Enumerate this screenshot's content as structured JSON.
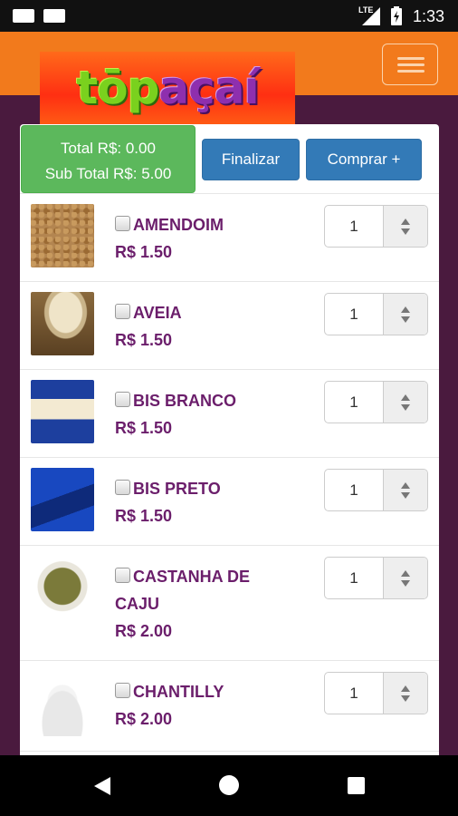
{
  "status_bar": {
    "time": "1:33",
    "network": "LTE"
  },
  "header": {
    "logo_text_green": "tōp",
    "logo_text_purple": "açaí",
    "menu_icon": "hamburger-icon"
  },
  "cart": {
    "total": "Total R$: 0.00",
    "subtotal": "Sub Total R$: 5.00",
    "finalize_label": "Finalizar",
    "buy_label": "Comprar +"
  },
  "products": [
    {
      "name": "AMENDOIM",
      "price": "R$ 1.50",
      "qty": "1"
    },
    {
      "name": "AVEIA",
      "price": "R$ 1.50",
      "qty": "1"
    },
    {
      "name": "BIS BRANCO",
      "price": "R$ 1.50",
      "qty": "1"
    },
    {
      "name": "BIS PRETO",
      "price": "R$ 1.50",
      "qty": "1"
    },
    {
      "name": "CASTANHA DE CAJU",
      "price": "R$ 2.00",
      "qty": "1"
    },
    {
      "name": "CHANTILLY",
      "price": "R$ 2.00",
      "qty": "1"
    }
  ],
  "colors": {
    "header": "#f27a1c",
    "background": "#4a1a3e",
    "accent_text": "#6b1e6b",
    "primary_button": "#337ab7",
    "success": "#5cb85c"
  }
}
